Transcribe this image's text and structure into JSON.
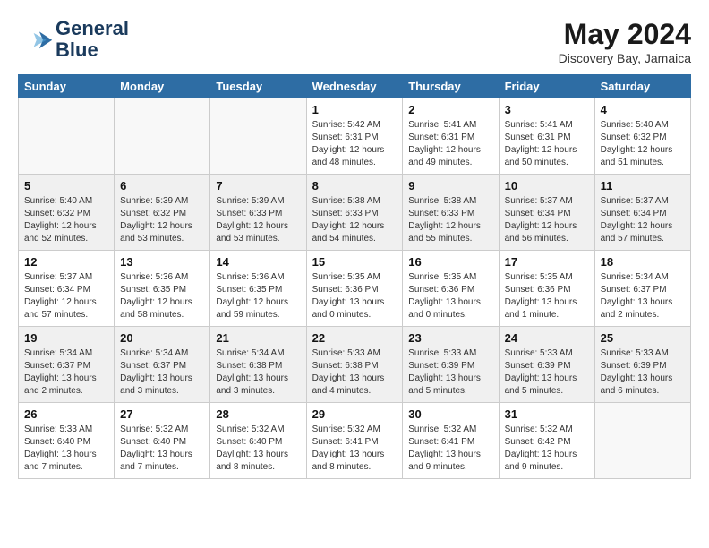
{
  "header": {
    "logo_line1": "General",
    "logo_line2": "Blue",
    "month_year": "May 2024",
    "location": "Discovery Bay, Jamaica"
  },
  "days_of_week": [
    "Sunday",
    "Monday",
    "Tuesday",
    "Wednesday",
    "Thursday",
    "Friday",
    "Saturday"
  ],
  "weeks": [
    [
      {
        "day": "",
        "info": ""
      },
      {
        "day": "",
        "info": ""
      },
      {
        "day": "",
        "info": ""
      },
      {
        "day": "1",
        "info": "Sunrise: 5:42 AM\nSunset: 6:31 PM\nDaylight: 12 hours\nand 48 minutes."
      },
      {
        "day": "2",
        "info": "Sunrise: 5:41 AM\nSunset: 6:31 PM\nDaylight: 12 hours\nand 49 minutes."
      },
      {
        "day": "3",
        "info": "Sunrise: 5:41 AM\nSunset: 6:31 PM\nDaylight: 12 hours\nand 50 minutes."
      },
      {
        "day": "4",
        "info": "Sunrise: 5:40 AM\nSunset: 6:32 PM\nDaylight: 12 hours\nand 51 minutes."
      }
    ],
    [
      {
        "day": "5",
        "info": "Sunrise: 5:40 AM\nSunset: 6:32 PM\nDaylight: 12 hours\nand 52 minutes."
      },
      {
        "day": "6",
        "info": "Sunrise: 5:39 AM\nSunset: 6:32 PM\nDaylight: 12 hours\nand 53 minutes."
      },
      {
        "day": "7",
        "info": "Sunrise: 5:39 AM\nSunset: 6:33 PM\nDaylight: 12 hours\nand 53 minutes."
      },
      {
        "day": "8",
        "info": "Sunrise: 5:38 AM\nSunset: 6:33 PM\nDaylight: 12 hours\nand 54 minutes."
      },
      {
        "day": "9",
        "info": "Sunrise: 5:38 AM\nSunset: 6:33 PM\nDaylight: 12 hours\nand 55 minutes."
      },
      {
        "day": "10",
        "info": "Sunrise: 5:37 AM\nSunset: 6:34 PM\nDaylight: 12 hours\nand 56 minutes."
      },
      {
        "day": "11",
        "info": "Sunrise: 5:37 AM\nSunset: 6:34 PM\nDaylight: 12 hours\nand 57 minutes."
      }
    ],
    [
      {
        "day": "12",
        "info": "Sunrise: 5:37 AM\nSunset: 6:34 PM\nDaylight: 12 hours\nand 57 minutes."
      },
      {
        "day": "13",
        "info": "Sunrise: 5:36 AM\nSunset: 6:35 PM\nDaylight: 12 hours\nand 58 minutes."
      },
      {
        "day": "14",
        "info": "Sunrise: 5:36 AM\nSunset: 6:35 PM\nDaylight: 12 hours\nand 59 minutes."
      },
      {
        "day": "15",
        "info": "Sunrise: 5:35 AM\nSunset: 6:36 PM\nDaylight: 13 hours\nand 0 minutes."
      },
      {
        "day": "16",
        "info": "Sunrise: 5:35 AM\nSunset: 6:36 PM\nDaylight: 13 hours\nand 0 minutes."
      },
      {
        "day": "17",
        "info": "Sunrise: 5:35 AM\nSunset: 6:36 PM\nDaylight: 13 hours\nand 1 minute."
      },
      {
        "day": "18",
        "info": "Sunrise: 5:34 AM\nSunset: 6:37 PM\nDaylight: 13 hours\nand 2 minutes."
      }
    ],
    [
      {
        "day": "19",
        "info": "Sunrise: 5:34 AM\nSunset: 6:37 PM\nDaylight: 13 hours\nand 2 minutes."
      },
      {
        "day": "20",
        "info": "Sunrise: 5:34 AM\nSunset: 6:37 PM\nDaylight: 13 hours\nand 3 minutes."
      },
      {
        "day": "21",
        "info": "Sunrise: 5:34 AM\nSunset: 6:38 PM\nDaylight: 13 hours\nand 3 minutes."
      },
      {
        "day": "22",
        "info": "Sunrise: 5:33 AM\nSunset: 6:38 PM\nDaylight: 13 hours\nand 4 minutes."
      },
      {
        "day": "23",
        "info": "Sunrise: 5:33 AM\nSunset: 6:39 PM\nDaylight: 13 hours\nand 5 minutes."
      },
      {
        "day": "24",
        "info": "Sunrise: 5:33 AM\nSunset: 6:39 PM\nDaylight: 13 hours\nand 5 minutes."
      },
      {
        "day": "25",
        "info": "Sunrise: 5:33 AM\nSunset: 6:39 PM\nDaylight: 13 hours\nand 6 minutes."
      }
    ],
    [
      {
        "day": "26",
        "info": "Sunrise: 5:33 AM\nSunset: 6:40 PM\nDaylight: 13 hours\nand 7 minutes."
      },
      {
        "day": "27",
        "info": "Sunrise: 5:32 AM\nSunset: 6:40 PM\nDaylight: 13 hours\nand 7 minutes."
      },
      {
        "day": "28",
        "info": "Sunrise: 5:32 AM\nSunset: 6:40 PM\nDaylight: 13 hours\nand 8 minutes."
      },
      {
        "day": "29",
        "info": "Sunrise: 5:32 AM\nSunset: 6:41 PM\nDaylight: 13 hours\nand 8 minutes."
      },
      {
        "day": "30",
        "info": "Sunrise: 5:32 AM\nSunset: 6:41 PM\nDaylight: 13 hours\nand 9 minutes."
      },
      {
        "day": "31",
        "info": "Sunrise: 5:32 AM\nSunset: 6:42 PM\nDaylight: 13 hours\nand 9 minutes."
      },
      {
        "day": "",
        "info": ""
      }
    ]
  ]
}
